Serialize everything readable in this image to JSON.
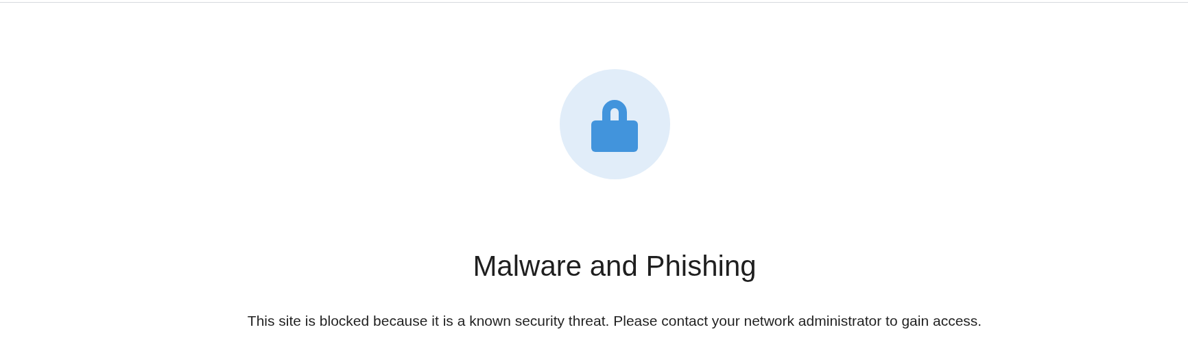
{
  "title": "Malware and Phishing",
  "message": "This site is blocked because it is a known security threat. Please contact your network administrator to gain access."
}
